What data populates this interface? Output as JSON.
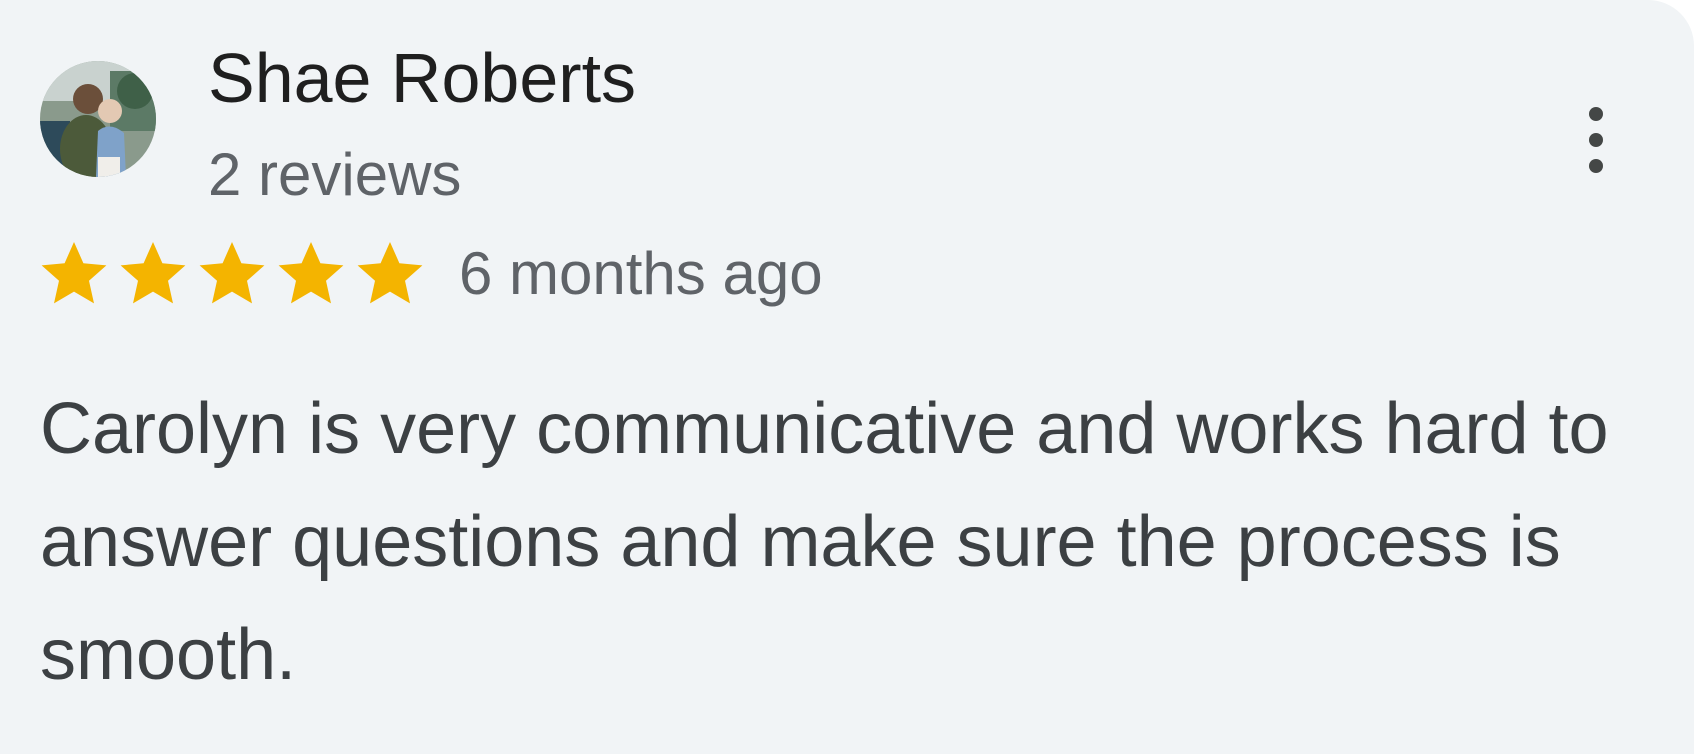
{
  "review": {
    "author": {
      "name": "Shae Roberts",
      "review_count": "2 reviews",
      "avatar_icon": "user-photo-avatar"
    },
    "rating": {
      "stars": 5,
      "max_stars": 5,
      "star_color": "#f4b400"
    },
    "date": "6 months ago",
    "text": "Carolyn is very communicative and works hard to answer questions and make sure the process is smooth.",
    "menu_icon": "more-vertical-icon"
  },
  "colors": {
    "card_background": "#f1f4f6",
    "name_text": "#1f1f1f",
    "secondary_text": "#5f6368",
    "body_text": "#3c4043",
    "menu_dots": "#444746"
  }
}
